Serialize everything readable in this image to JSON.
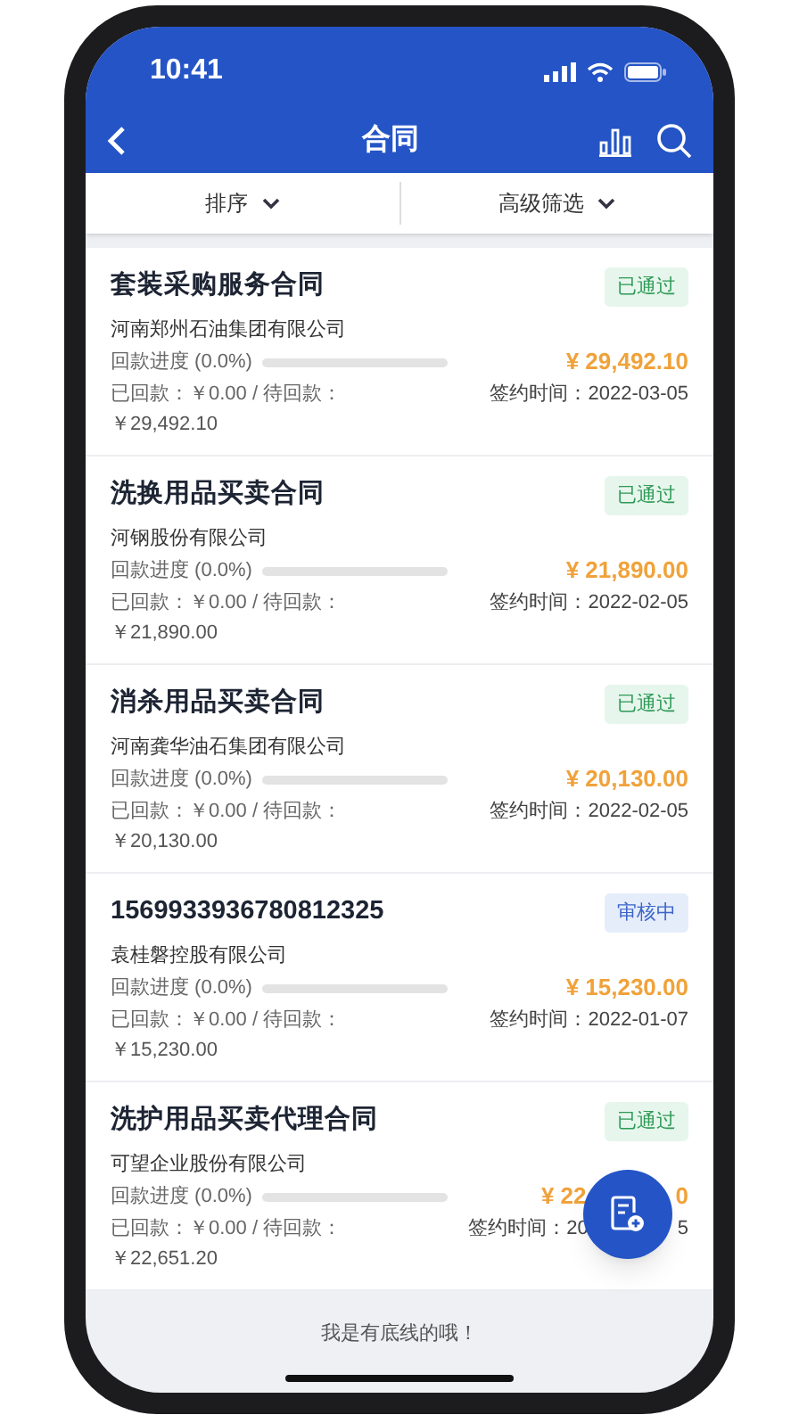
{
  "status_bar": {
    "time": "10:41"
  },
  "nav": {
    "title": "合同"
  },
  "filters": [
    {
      "label": "排序"
    },
    {
      "label": "高级筛选"
    }
  ],
  "contracts": [
    {
      "title": "套装采购服务合同",
      "kind": "approved",
      "status_label": "已通过",
      "company": "河南郑州石油集团有限公司",
      "progress_label": "回款进度 (0.0%)",
      "level": 0,
      "amount": "¥ 29,492.10",
      "paid": "已回款：￥0.00 / 待回款：",
      "signed": "签约时间：2022-03-05",
      "pending": "￥29,492.10"
    },
    {
      "title": "洗换用品买卖合同",
      "kind": "approved",
      "status_label": "已通过",
      "company": "河钢股份有限公司",
      "progress_label": "回款进度 (0.0%)",
      "level": 0,
      "amount": "¥ 21,890.00",
      "paid": "已回款：￥0.00 / 待回款：",
      "signed": "签约时间：2022-02-05",
      "pending": "￥21,890.00"
    },
    {
      "title": "消杀用品买卖合同",
      "kind": "approved",
      "status_label": "已通过",
      "company": "河南龚华油石集团有限公司",
      "progress_label": "回款进度 (0.0%)",
      "level": 0,
      "amount": "¥ 20,130.00",
      "paid": "已回款：￥0.00 / 待回款：",
      "signed": "签约时间：2022-02-05",
      "pending": "￥20,130.00"
    },
    {
      "title": "1569933936780812325",
      "kind": "reviewing",
      "status_label": "审核中",
      "company": "袁桂磐控股有限公司",
      "progress_label": "回款进度 (0.0%)",
      "level": 0,
      "amount": "¥ 15,230.00",
      "paid": "已回款：￥0.00 / 待回款：",
      "signed": "签约时间：2022-01-07",
      "pending": "￥15,230.00"
    },
    {
      "title": "洗护用品买卖代理合同",
      "kind": "approved",
      "status_label": "已通过",
      "company": "可望企业股份有限公司",
      "progress_label": "回款进度 (0.0%)",
      "level": 0,
      "amount": "¥ 22",
      "amount_tail": "0",
      "paid": "已回款：￥0.00 / 待回款：",
      "signed": "签约时间：20",
      "signed_tail": "5",
      "pending": "￥22,651.20"
    }
  ],
  "footer": {
    "text": "我是有底线的哦！"
  }
}
